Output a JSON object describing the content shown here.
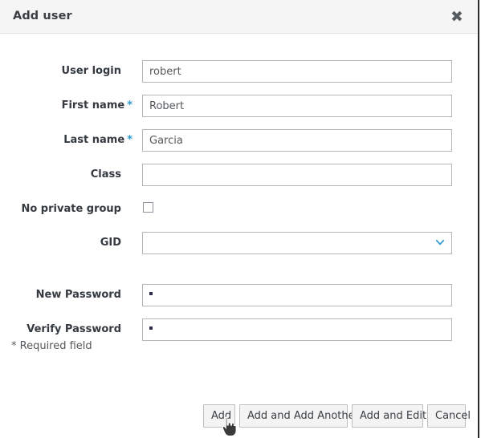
{
  "dialog": {
    "title": "Add user",
    "close_icon": "close-icon"
  },
  "form": {
    "rows": [
      {
        "label": "User login",
        "required": false,
        "type": "text",
        "value": "robert",
        "placeholder": ""
      },
      {
        "label": "First name",
        "required": true,
        "type": "text",
        "value": "Robert",
        "placeholder": ""
      },
      {
        "label": "Last name",
        "required": true,
        "type": "text",
        "value": "Garcia",
        "placeholder": ""
      },
      {
        "label": "Class",
        "required": false,
        "type": "text",
        "value": "",
        "placeholder": ""
      },
      {
        "label": "No private group",
        "required": false,
        "type": "checkbox",
        "checked": false
      },
      {
        "label": "GID",
        "required": false,
        "type": "select",
        "value": "",
        "icon": "chevron-down-icon"
      },
      {
        "label": "New Password",
        "required": false,
        "type": "password",
        "value": "•"
      },
      {
        "label": "Verify Password",
        "required": false,
        "type": "password",
        "value": "•"
      }
    ],
    "required_note": "* Required field",
    "required_marker": "*"
  },
  "footer": {
    "buttons": [
      {
        "label": "Add"
      },
      {
        "label": "Add and Add Another"
      },
      {
        "label": "Add and Edit"
      },
      {
        "label": "Cancel"
      }
    ]
  },
  "colors": {
    "header_bg": "#f5f5f5",
    "accent_blue": "#2e9ad0",
    "label_text": "#343a40",
    "button_bg": "#f4f4f4",
    "border": "#b5b5b5"
  },
  "cursor": {
    "type": "pointer-hand-cursor"
  }
}
